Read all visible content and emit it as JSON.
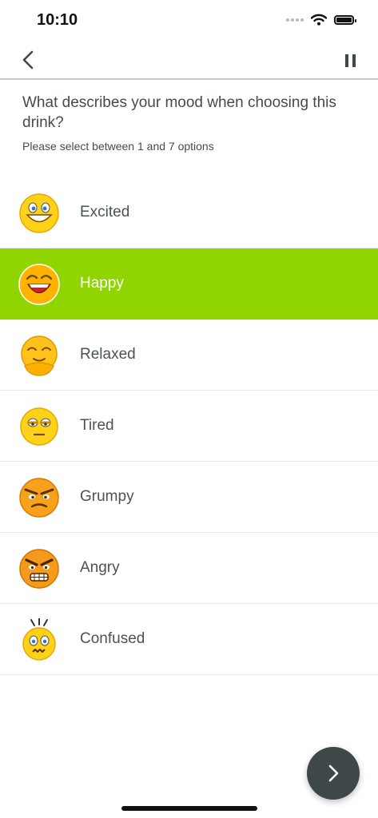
{
  "status_bar": {
    "time": "10:10"
  },
  "nav": {
    "back_icon": "chevron-left-icon",
    "pause_icon": "pause-icon"
  },
  "question": {
    "title": "What describes your mood when choosing this drink?",
    "hint": "Please select between 1 and 7 options"
  },
  "options": [
    {
      "label": "Excited",
      "icon": "excited-emoji-icon",
      "selected": false
    },
    {
      "label": "Happy",
      "icon": "happy-emoji-icon",
      "selected": true
    },
    {
      "label": "Relaxed",
      "icon": "relaxed-emoji-icon",
      "selected": false
    },
    {
      "label": "Tired",
      "icon": "tired-emoji-icon",
      "selected": false
    },
    {
      "label": "Grumpy",
      "icon": "grumpy-emoji-icon",
      "selected": false
    },
    {
      "label": "Angry",
      "icon": "angry-emoji-icon",
      "selected": false
    },
    {
      "label": "Confused",
      "icon": "confused-emoji-icon",
      "selected": false
    }
  ],
  "next_button": {
    "icon": "chevron-right-icon"
  },
  "colors": {
    "selected": "#90d400",
    "next_button": "#3f4849",
    "text": "#444b4f"
  }
}
